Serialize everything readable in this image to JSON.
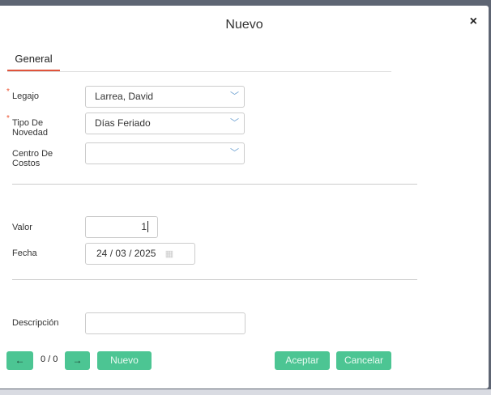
{
  "dialog": {
    "title": "Nuevo",
    "close_icon": "×"
  },
  "tabs": [
    {
      "label": "General"
    }
  ],
  "form": {
    "legajo": {
      "label": "Legajo",
      "value": "Larrea, David",
      "required": true
    },
    "tipo": {
      "label_line1": "Tipo De",
      "label_line2": "Novedad",
      "value": "Días Feriado",
      "required": true
    },
    "centro": {
      "label_line1": "Centro De",
      "label_line2": "Costos",
      "value": ""
    },
    "valor": {
      "label": "Valor",
      "value": "1"
    },
    "fecha": {
      "label": "Fecha",
      "day": "24",
      "month": "03",
      "year": "2025"
    },
    "descripcion": {
      "label": "Descripción",
      "value": ""
    }
  },
  "footer": {
    "pager": "0 / 0",
    "nuevo": "Nuevo",
    "aceptar": "Aceptar",
    "cancelar": "Cancelar"
  },
  "colors": {
    "accent": "#4cc593",
    "tab_underline": "#e0533b"
  }
}
